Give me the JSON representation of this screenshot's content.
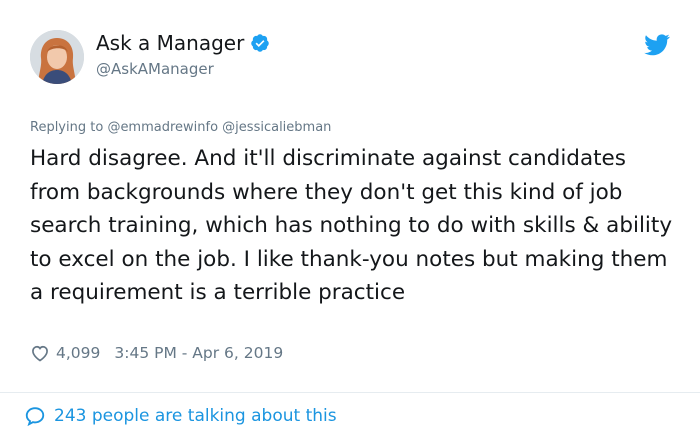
{
  "author": {
    "display_name": "Ask a Manager",
    "handle": "@AskAManager",
    "verified_icon": "verified-badge-icon"
  },
  "brand": {
    "icon": "twitter-bird-icon",
    "color": "#1da1f2"
  },
  "reply": {
    "prefix": "Replying to",
    "mentions": "@emmadrewinfo @jessicaliebman"
  },
  "tweet": {
    "text": "Hard disagree. And it'll discriminate against candidates from backgrounds where they don't get this kind of job search training, which has nothing to do with skills & ability to excel on the job. I like thank-you notes but making them a requirement is a terrible practice"
  },
  "meta": {
    "like_icon": "heart-icon",
    "likes": "4,099",
    "timestamp": "3:45 PM - Apr 6, 2019"
  },
  "footer": {
    "icon": "speech-bubble-icon",
    "talking": "243 people are talking about this",
    "link_color": "#1b95e0"
  }
}
